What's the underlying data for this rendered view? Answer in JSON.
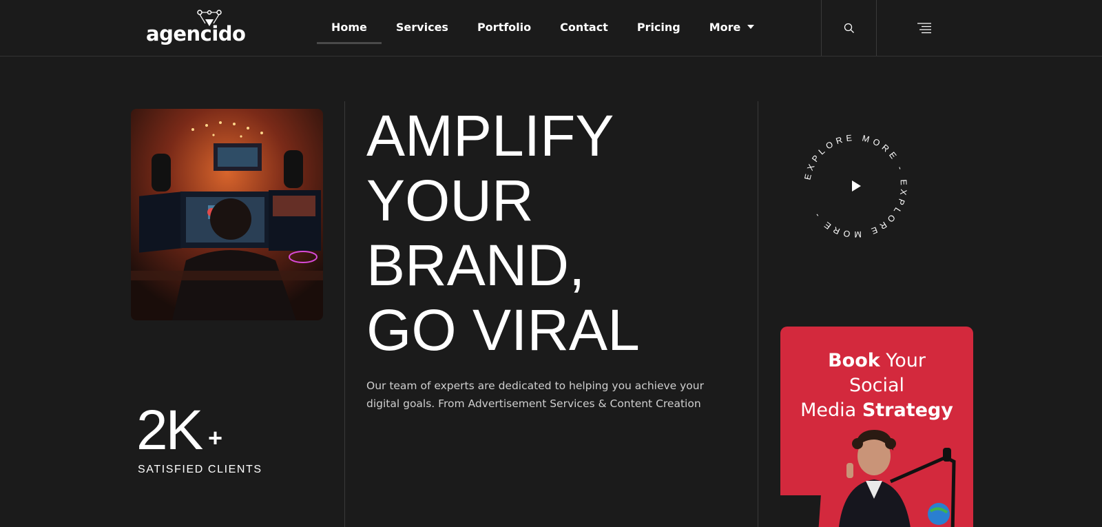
{
  "brand": {
    "logo_text": "agencido"
  },
  "nav": {
    "items": [
      {
        "label": "Home",
        "active": true
      },
      {
        "label": "Services"
      },
      {
        "label": "Portfolio"
      },
      {
        "label": "Contact"
      },
      {
        "label": "Pricing"
      },
      {
        "label": "More",
        "dropdown": true
      }
    ]
  },
  "header_icons": {
    "search": "search-icon",
    "menu": "hamburger-menu-icon"
  },
  "hero": {
    "headline": [
      "AMPLIFY",
      "YOUR",
      "BRAND,",
      "GO VIRAL"
    ],
    "description": "Our team of experts are dedicated to helping you achieve your digital goals. From Advertisement Services & Content Creation"
  },
  "stats": {
    "value": "2K",
    "suffix": "+",
    "label": "SATISFIED CLIENTS"
  },
  "explore_badge": {
    "text": "EXPLORE MORE - EXPLORE MORE - ",
    "icon": "play-icon"
  },
  "promo": {
    "word1": "Book",
    "word2": "Your",
    "word3": "Social",
    "word4": "Media",
    "word5": "Strategy"
  },
  "colors": {
    "background": "#1b1b1b",
    "promo_red": "#d3293d",
    "divider": "#3a3a3a"
  }
}
